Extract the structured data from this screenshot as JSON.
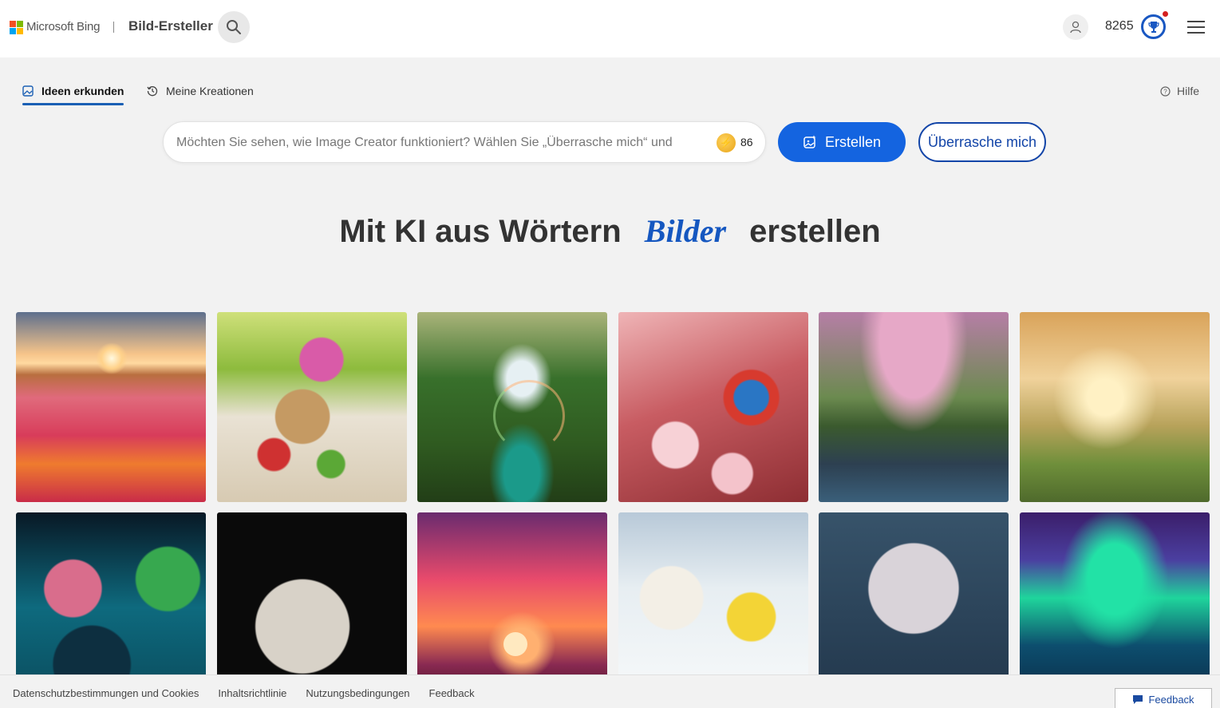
{
  "header": {
    "brand": "Microsoft Bing",
    "product": "Bild-Ersteller",
    "points": "8265",
    "logo_colors": [
      "#f25022",
      "#7fba00",
      "#00a4ef",
      "#ffb900"
    ]
  },
  "tabs": {
    "explore": "Ideen erkunden",
    "my_creations": "Meine Kreationen",
    "help": "Hilfe"
  },
  "prompt": {
    "placeholder": "Möchten Sie sehen, wie Image Creator funktioniert? Wählen Sie „Überrasche mich“ und",
    "boosts": "86",
    "create_label": "Erstellen",
    "surprise_label": "Überrasche mich"
  },
  "hero": {
    "before": "Mit KI aus Wörtern",
    "accent": "Bilder",
    "after": "erstellen"
  },
  "gallery": {
    "tiles": [
      "tulip-field-sunset-image",
      "picnic-basket-flowers-image",
      "waterfall-rainbow-jungle-image",
      "butterfly-cherry-blossom-image",
      "cherry-tree-stream-image",
      "child-kite-park-image",
      "neon-fantasy-trees-image",
      "floral-crescent-moon-image",
      "horse-rider-silhouette-sunset-image",
      "polar-bears-lemonade-image",
      "silver-flower-bouquet-image",
      "aurora-borealis-landscape-image"
    ]
  },
  "footer": {
    "links": [
      "Datenschutzbestimmungen und Cookies",
      "Inhaltsrichtlinie",
      "Nutzungsbedingungen",
      "Feedback"
    ],
    "feedback_button": "Feedback"
  },
  "colors": {
    "accent": "#1464e0",
    "accent_dark": "#1345a8"
  }
}
